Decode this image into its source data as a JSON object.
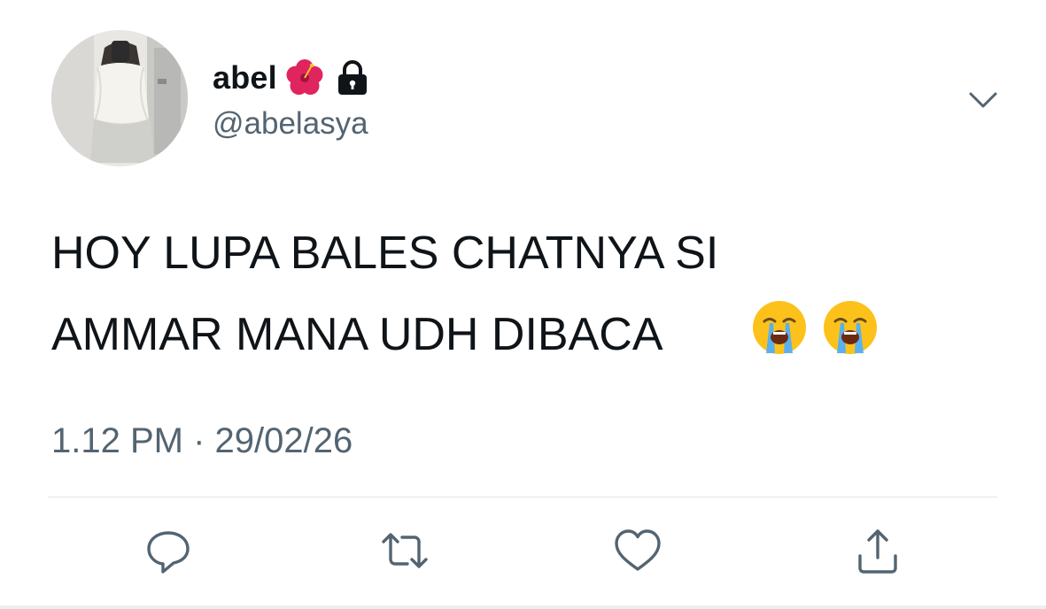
{
  "tweet": {
    "author": {
      "display_name": "abel",
      "handle": "@abelasya",
      "name_icons": [
        "hibiscus-icon",
        "lock-icon"
      ]
    },
    "text_line1": "HOY LUPA BALES CHATNYA SI",
    "text_line2": "AMMAR MANA UDH DIBACA",
    "text_emojis": [
      "loudly-crying-face-icon",
      "loudly-crying-face-icon"
    ],
    "timestamp": "1.12 PM · 29/02/26",
    "actions": [
      "reply-icon",
      "retweet-icon",
      "like-icon",
      "share-icon"
    ],
    "more_menu_icon": "chevron-down-icon"
  },
  "colors": {
    "text_primary": "#0f1419",
    "text_secondary": "#536471",
    "divider": "#e1e6ea"
  }
}
